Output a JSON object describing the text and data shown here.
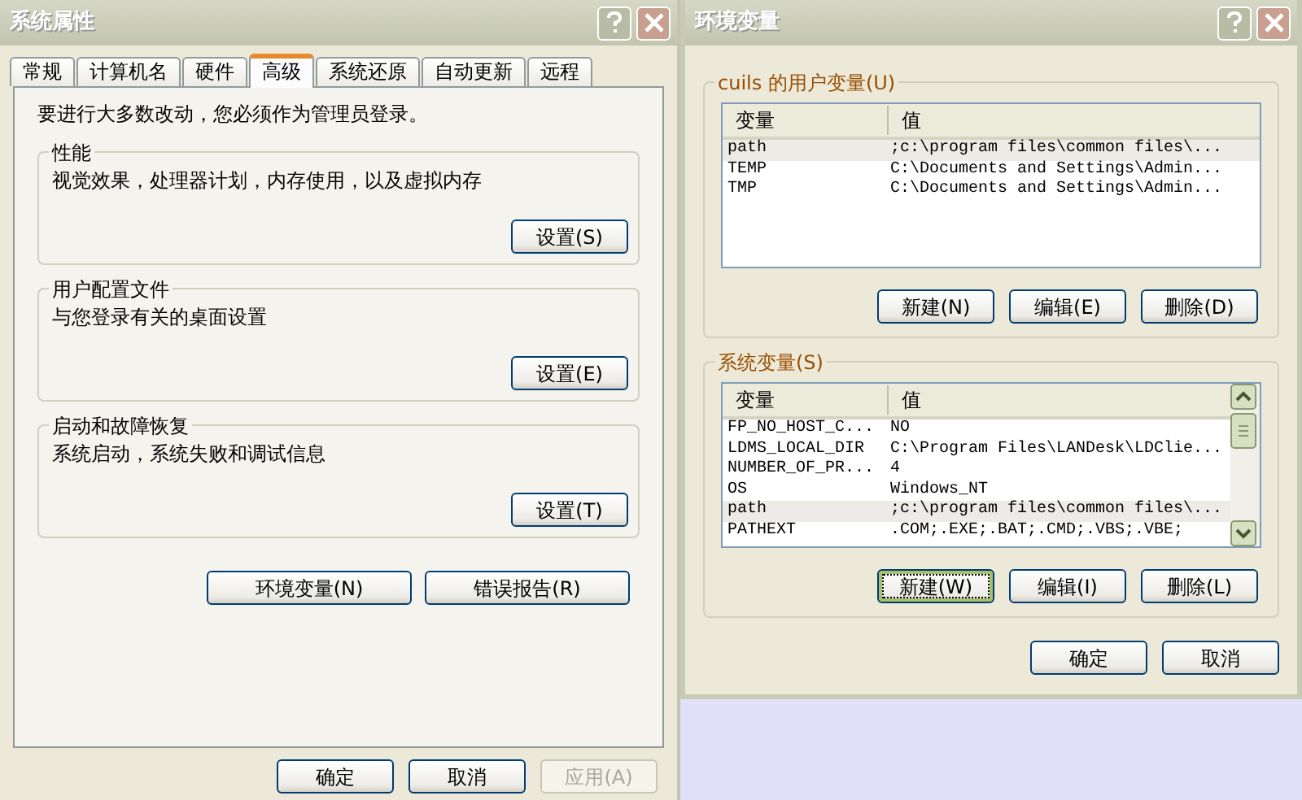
{
  "system_properties": {
    "title": "系统属性",
    "tabs": [
      {
        "label": "常规",
        "selected": false
      },
      {
        "label": "计算机名",
        "selected": false
      },
      {
        "label": "硬件",
        "selected": false
      },
      {
        "label": "高级",
        "selected": true
      },
      {
        "label": "系统还原",
        "selected": false
      },
      {
        "label": "自动更新",
        "selected": false
      },
      {
        "label": "远程",
        "selected": false
      }
    ],
    "notice": "要进行大多数改动，您必须作为管理员登录。",
    "groups": [
      {
        "title": "性能",
        "description": "视觉效果，处理器计划，内存使用，以及虚拟内存",
        "button": "设置(S)"
      },
      {
        "title": "用户配置文件",
        "description": "与您登录有关的桌面设置",
        "button": "设置(E)"
      },
      {
        "title": "启动和故障恢复",
        "description": "系统启动，系统失败和调试信息",
        "button": "设置(T)"
      }
    ],
    "extra_buttons": [
      "环境变量(N)",
      "错误报告(R)"
    ],
    "buttons": [
      {
        "label": "确定",
        "disabled": false
      },
      {
        "label": "取消",
        "disabled": false
      },
      {
        "label": "应用(A)",
        "disabled": true
      }
    ]
  },
  "environment_variables": {
    "title": "环境变量",
    "user_group": {
      "title": "cuils 的用户变量(U)",
      "columns": [
        "变量",
        "值"
      ],
      "rows": [
        {
          "variable": "path",
          "value": ";c:\\program files\\common files\\...",
          "selected": true
        },
        {
          "variable": "TEMP",
          "value": "C:\\Documents and Settings\\Admin...",
          "selected": false
        },
        {
          "variable": "TMP",
          "value": "C:\\Documents and Settings\\Admin...",
          "selected": false
        }
      ],
      "buttons": [
        {
          "label": "新建(N)",
          "focused": false
        },
        {
          "label": "编辑(E)",
          "focused": false
        },
        {
          "label": "删除(D)",
          "focused": false
        }
      ]
    },
    "system_group": {
      "title": "系统变量(S)",
      "columns": [
        "变量",
        "值"
      ],
      "rows": [
        {
          "variable": "FP_NO_HOST_C...",
          "value": "NO",
          "selected": false
        },
        {
          "variable": "LDMS_LOCAL_DIR",
          "value": "C:\\Program Files\\LANDesk\\LDClie...",
          "selected": false
        },
        {
          "variable": "NUMBER_OF_PR...",
          "value": "4",
          "selected": false
        },
        {
          "variable": "OS",
          "value": "Windows_NT",
          "selected": false
        },
        {
          "variable": "path",
          "value": ";c:\\program files\\common files\\...",
          "selected": true
        },
        {
          "variable": "PATHEXT",
          "value": ".COM;.EXE;.BAT;.CMD;.VBS;.VBE;",
          "selected": false
        }
      ],
      "buttons": [
        {
          "label": "新建(W)",
          "focused": true
        },
        {
          "label": "编辑(I)",
          "focused": false
        },
        {
          "label": "删除(L)",
          "focused": false
        }
      ]
    },
    "buttons": [
      "确定",
      "取消"
    ]
  }
}
